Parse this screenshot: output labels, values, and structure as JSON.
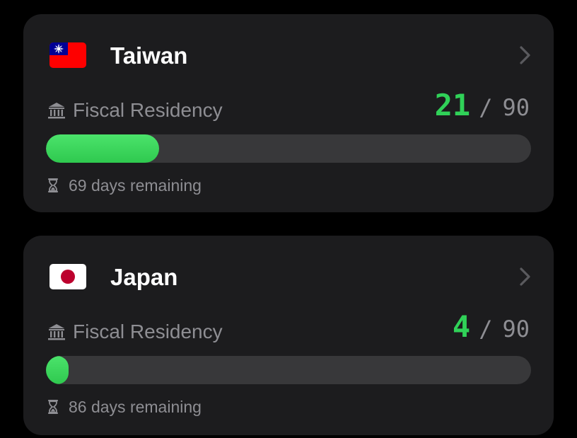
{
  "cards": [
    {
      "country": "Taiwan",
      "flag_icon": "taiwan-flag",
      "residency_icon": "bank-icon",
      "residency_label": "Fiscal Residency",
      "days_counted": 21,
      "days_limit": 90,
      "separator": "/",
      "progress_fraction": 0.2333,
      "remaining_icon": "hourglass-icon",
      "remaining_text": "69 days remaining"
    },
    {
      "country": "Japan",
      "flag_icon": "japan-flag",
      "residency_icon": "bank-icon",
      "residency_label": "Fiscal Residency",
      "days_counted": 4,
      "days_limit": 90,
      "separator": "/",
      "progress_fraction": 0.0444,
      "remaining_icon": "hourglass-icon",
      "remaining_text": "86 days remaining"
    }
  ],
  "colors": {
    "background": "#000000",
    "card": "#1c1c1e",
    "accent_green": "#30d158",
    "track": "#38383a",
    "secondary_text": "#8e8e93",
    "primary_text": "#ffffff"
  }
}
